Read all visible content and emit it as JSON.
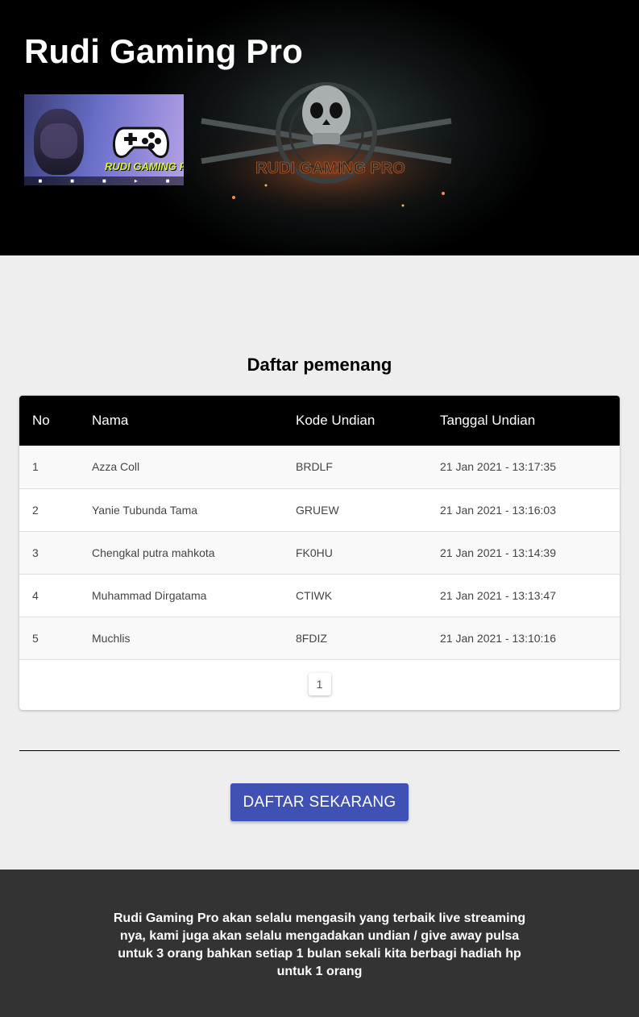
{
  "header": {
    "title": "Rudi Gaming Pro",
    "avatar_brand_text": "RUDI GAMING PRO",
    "banner_text": "RUDI GAMING PRO"
  },
  "winners": {
    "title": "Daftar pemenang",
    "columns": [
      "No",
      "Nama",
      "Kode Undian",
      "Tanggal Undian"
    ],
    "rows": [
      [
        "1",
        "Azza Coll",
        "BRDLF",
        "21 Jan 2021 - 13:17:35"
      ],
      [
        "2",
        "Yanie Tubunda Tama",
        "GRUEW",
        "21 Jan 2021 - 13:16:03"
      ],
      [
        "3",
        "Chengkal putra mahkota",
        "FK0HU",
        "21 Jan 2021 - 13:14:39"
      ],
      [
        "4",
        "Muhammad Dirgatama",
        "CTIWK",
        "21 Jan 2021 - 13:13:47"
      ],
      [
        "5",
        "Muchlis",
        "8FDIZ",
        "21 Jan 2021 - 13:10:16"
      ]
    ],
    "pagination": {
      "current_page": "1"
    }
  },
  "cta": {
    "label": "DAFTAR SEKARANG",
    "color": "#3f51b5"
  },
  "footer": {
    "text": "Rudi Gaming Pro akan selalu mengasih yang terbaik live streaming nya, kami juga akan selalu mengadakan undian / give away pulsa untuk 3 orang bahkan setiap 1 bulan sekali kita berbagi hadiah hp untuk 1 orang"
  },
  "colors": {
    "header_bg": "#000000",
    "page_bg": "#eeeeee",
    "table_header_bg": "#000000",
    "footer_bg": "#333333"
  }
}
